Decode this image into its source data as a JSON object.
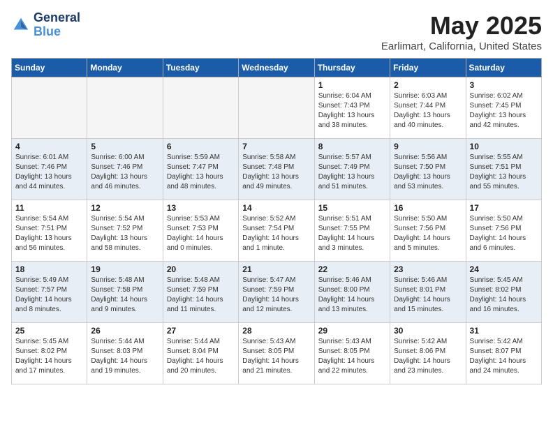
{
  "header": {
    "logo_line1": "General",
    "logo_line2": "Blue",
    "month": "May 2025",
    "location": "Earlimart, California, United States"
  },
  "weekdays": [
    "Sunday",
    "Monday",
    "Tuesday",
    "Wednesday",
    "Thursday",
    "Friday",
    "Saturday"
  ],
  "weeks": [
    [
      {
        "day": "",
        "detail": ""
      },
      {
        "day": "",
        "detail": ""
      },
      {
        "day": "",
        "detail": ""
      },
      {
        "day": "",
        "detail": ""
      },
      {
        "day": "1",
        "detail": "Sunrise: 6:04 AM\nSunset: 7:43 PM\nDaylight: 13 hours\nand 38 minutes."
      },
      {
        "day": "2",
        "detail": "Sunrise: 6:03 AM\nSunset: 7:44 PM\nDaylight: 13 hours\nand 40 minutes."
      },
      {
        "day": "3",
        "detail": "Sunrise: 6:02 AM\nSunset: 7:45 PM\nDaylight: 13 hours\nand 42 minutes."
      }
    ],
    [
      {
        "day": "4",
        "detail": "Sunrise: 6:01 AM\nSunset: 7:46 PM\nDaylight: 13 hours\nand 44 minutes."
      },
      {
        "day": "5",
        "detail": "Sunrise: 6:00 AM\nSunset: 7:46 PM\nDaylight: 13 hours\nand 46 minutes."
      },
      {
        "day": "6",
        "detail": "Sunrise: 5:59 AM\nSunset: 7:47 PM\nDaylight: 13 hours\nand 48 minutes."
      },
      {
        "day": "7",
        "detail": "Sunrise: 5:58 AM\nSunset: 7:48 PM\nDaylight: 13 hours\nand 49 minutes."
      },
      {
        "day": "8",
        "detail": "Sunrise: 5:57 AM\nSunset: 7:49 PM\nDaylight: 13 hours\nand 51 minutes."
      },
      {
        "day": "9",
        "detail": "Sunrise: 5:56 AM\nSunset: 7:50 PM\nDaylight: 13 hours\nand 53 minutes."
      },
      {
        "day": "10",
        "detail": "Sunrise: 5:55 AM\nSunset: 7:51 PM\nDaylight: 13 hours\nand 55 minutes."
      }
    ],
    [
      {
        "day": "11",
        "detail": "Sunrise: 5:54 AM\nSunset: 7:51 PM\nDaylight: 13 hours\nand 56 minutes."
      },
      {
        "day": "12",
        "detail": "Sunrise: 5:54 AM\nSunset: 7:52 PM\nDaylight: 13 hours\nand 58 minutes."
      },
      {
        "day": "13",
        "detail": "Sunrise: 5:53 AM\nSunset: 7:53 PM\nDaylight: 14 hours\nand 0 minutes."
      },
      {
        "day": "14",
        "detail": "Sunrise: 5:52 AM\nSunset: 7:54 PM\nDaylight: 14 hours\nand 1 minute."
      },
      {
        "day": "15",
        "detail": "Sunrise: 5:51 AM\nSunset: 7:55 PM\nDaylight: 14 hours\nand 3 minutes."
      },
      {
        "day": "16",
        "detail": "Sunrise: 5:50 AM\nSunset: 7:56 PM\nDaylight: 14 hours\nand 5 minutes."
      },
      {
        "day": "17",
        "detail": "Sunrise: 5:50 AM\nSunset: 7:56 PM\nDaylight: 14 hours\nand 6 minutes."
      }
    ],
    [
      {
        "day": "18",
        "detail": "Sunrise: 5:49 AM\nSunset: 7:57 PM\nDaylight: 14 hours\nand 8 minutes."
      },
      {
        "day": "19",
        "detail": "Sunrise: 5:48 AM\nSunset: 7:58 PM\nDaylight: 14 hours\nand 9 minutes."
      },
      {
        "day": "20",
        "detail": "Sunrise: 5:48 AM\nSunset: 7:59 PM\nDaylight: 14 hours\nand 11 minutes."
      },
      {
        "day": "21",
        "detail": "Sunrise: 5:47 AM\nSunset: 7:59 PM\nDaylight: 14 hours\nand 12 minutes."
      },
      {
        "day": "22",
        "detail": "Sunrise: 5:46 AM\nSunset: 8:00 PM\nDaylight: 14 hours\nand 13 minutes."
      },
      {
        "day": "23",
        "detail": "Sunrise: 5:46 AM\nSunset: 8:01 PM\nDaylight: 14 hours\nand 15 minutes."
      },
      {
        "day": "24",
        "detail": "Sunrise: 5:45 AM\nSunset: 8:02 PM\nDaylight: 14 hours\nand 16 minutes."
      }
    ],
    [
      {
        "day": "25",
        "detail": "Sunrise: 5:45 AM\nSunset: 8:02 PM\nDaylight: 14 hours\nand 17 minutes."
      },
      {
        "day": "26",
        "detail": "Sunrise: 5:44 AM\nSunset: 8:03 PM\nDaylight: 14 hours\nand 19 minutes."
      },
      {
        "day": "27",
        "detail": "Sunrise: 5:44 AM\nSunset: 8:04 PM\nDaylight: 14 hours\nand 20 minutes."
      },
      {
        "day": "28",
        "detail": "Sunrise: 5:43 AM\nSunset: 8:05 PM\nDaylight: 14 hours\nand 21 minutes."
      },
      {
        "day": "29",
        "detail": "Sunrise: 5:43 AM\nSunset: 8:05 PM\nDaylight: 14 hours\nand 22 minutes."
      },
      {
        "day": "30",
        "detail": "Sunrise: 5:42 AM\nSunset: 8:06 PM\nDaylight: 14 hours\nand 23 minutes."
      },
      {
        "day": "31",
        "detail": "Sunrise: 5:42 AM\nSunset: 8:07 PM\nDaylight: 14 hours\nand 24 minutes."
      }
    ]
  ]
}
